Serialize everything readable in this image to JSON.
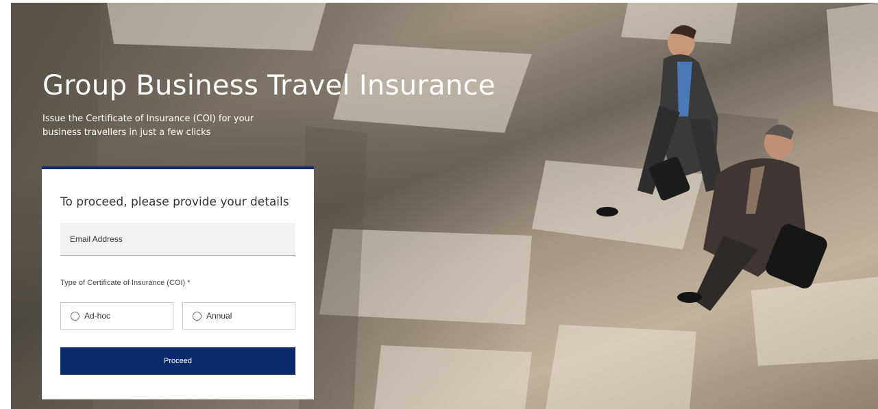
{
  "hero": {
    "title": "Group Business Travel Insurance",
    "subtitle": "Issue the Certificate of Insurance (COI) for your business travellers in just a few clicks"
  },
  "form": {
    "heading": "To proceed, please provide your details",
    "email": {
      "placeholder": "Email Address",
      "value": ""
    },
    "coi_type": {
      "label": "Type of Certificate of Insurance (COI) *",
      "options": [
        {
          "label": "Ad-hoc",
          "selected": false
        },
        {
          "label": "Annual",
          "selected": false
        }
      ]
    },
    "proceed_label": "Proceed"
  },
  "colors": {
    "accent": "#0b2a6e",
    "card_background": "#ffffff",
    "field_background": "#f2f2f2"
  }
}
